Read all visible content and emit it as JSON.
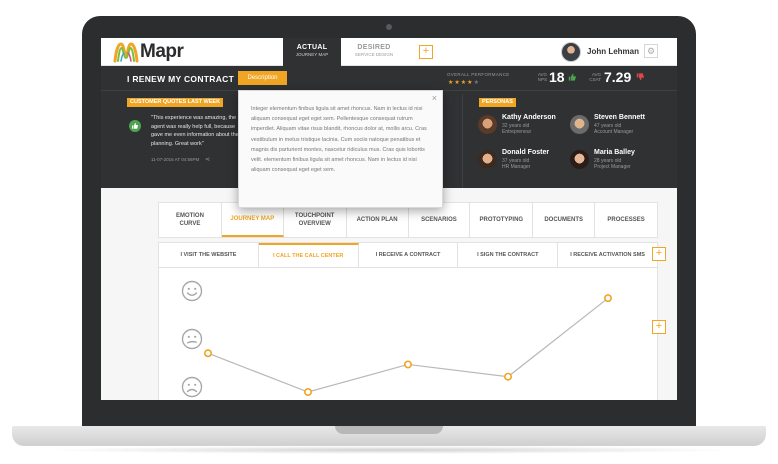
{
  "header": {
    "logo_text": "Mapr",
    "tab_actual": {
      "title": "ACTUAL",
      "subtitle": "JOURNEY MAP"
    },
    "tab_desired": {
      "title": "DESIRED",
      "subtitle": "SERVICE DESIGN"
    },
    "plus_label": "+",
    "user_name": "John Lehman",
    "gear_glyph": "⚙"
  },
  "summary": {
    "title": "I RENEW MY CONTRACT",
    "description_button": "Description",
    "overall_performance_label": "OVERALL PERFORMANCE",
    "stars_filled": 4,
    "stars_total": 5,
    "nps_label": "AVG NPS",
    "nps_value": "18",
    "csat_label": "AVG CSAT",
    "csat_value": "7.29",
    "colors": {
      "accent": "#f0a524",
      "positive": "#4fa24f",
      "negative": "#e04848",
      "dark": "#2f3133"
    }
  },
  "quotes": {
    "badge": "CUSTOMER QUOTES LAST WEEK",
    "text": "\"This experience was amazing, the agent was really help full, because gave me even information about the planning. Great work\"",
    "date": "11-07-2016 AT 04:56PM",
    "share_glyph": "⋖"
  },
  "personas": {
    "badge": "PERSONAS",
    "items": [
      {
        "name": "Kathy Anderson",
        "age": "32 years old",
        "role": "Entrepreneur",
        "skin": "#d9a07a",
        "hair": "#5a3a28"
      },
      {
        "name": "Steven Bennett",
        "age": "47 years old",
        "role": "Account Manager",
        "skin": "#e0b48f",
        "hair": "#6b6b6b"
      },
      {
        "name": "Donald Foster",
        "age": "37 years old",
        "role": "HR Manager",
        "skin": "#e2b08b",
        "hair": "#3b2a20"
      },
      {
        "name": "Maria Balley",
        "age": "28 years old",
        "role": "Project Manager",
        "skin": "#e6b89a",
        "hair": "#2a1c16"
      }
    ]
  },
  "popup": {
    "close_glyph": "×",
    "text": "Integer elementum finibus ligula sit amet rhoncus. Nam in lectus id nisi aliquam consequat eget eget sem. Pellentesque consequat rutrum imperdiet. Aliquam vitae risus blandit, rhoncus dolor at, mollis arcu. Cras vestibulum in metus tristique lacinia. Cum sociis natoque penatibus et magnis dis parturient montes, nascetur ridiculus mus. Cras quis lobortis velit. elementum finibus ligula sit amet rhoncus. Nam in lectus id nisi aliquam consequat eget eget sem."
  },
  "main_tabs": [
    {
      "label": "EMOTION CURVE",
      "active": false
    },
    {
      "label": "JOURNEY MAP",
      "active": true
    },
    {
      "label": "TOUCHPOINT OVERVIEW",
      "active": false
    },
    {
      "label": "ACTION PLAN",
      "active": false
    },
    {
      "label": "SCENARIOS",
      "active": false
    },
    {
      "label": "PROTOTYPING",
      "active": false
    },
    {
      "label": "DOCUMENTS",
      "active": false
    },
    {
      "label": "PROCESSES",
      "active": false
    }
  ],
  "steps": [
    {
      "label": "I VISIT THE WEBSITE",
      "active": false
    },
    {
      "label": "I CALL THE CALL CENTER",
      "active": true
    },
    {
      "label": "I RECEIVE A CONTRACT",
      "active": false
    },
    {
      "label": "I SIGN THE CONTRACT",
      "active": false
    },
    {
      "label": "I RECEIVE ACTIVATION SMS",
      "active": false
    }
  ],
  "emotion_icons": [
    "happy-face-icon",
    "neutral-face-icon",
    "sad-face-icon"
  ],
  "emotion_curve": {
    "levels": [
      "happy",
      "neutral",
      "sad"
    ],
    "points": [
      0.38,
      0.0,
      0.27,
      0.15,
      0.92
    ],
    "line_color": "#b8b8b8",
    "point_color": "#f0a524"
  }
}
